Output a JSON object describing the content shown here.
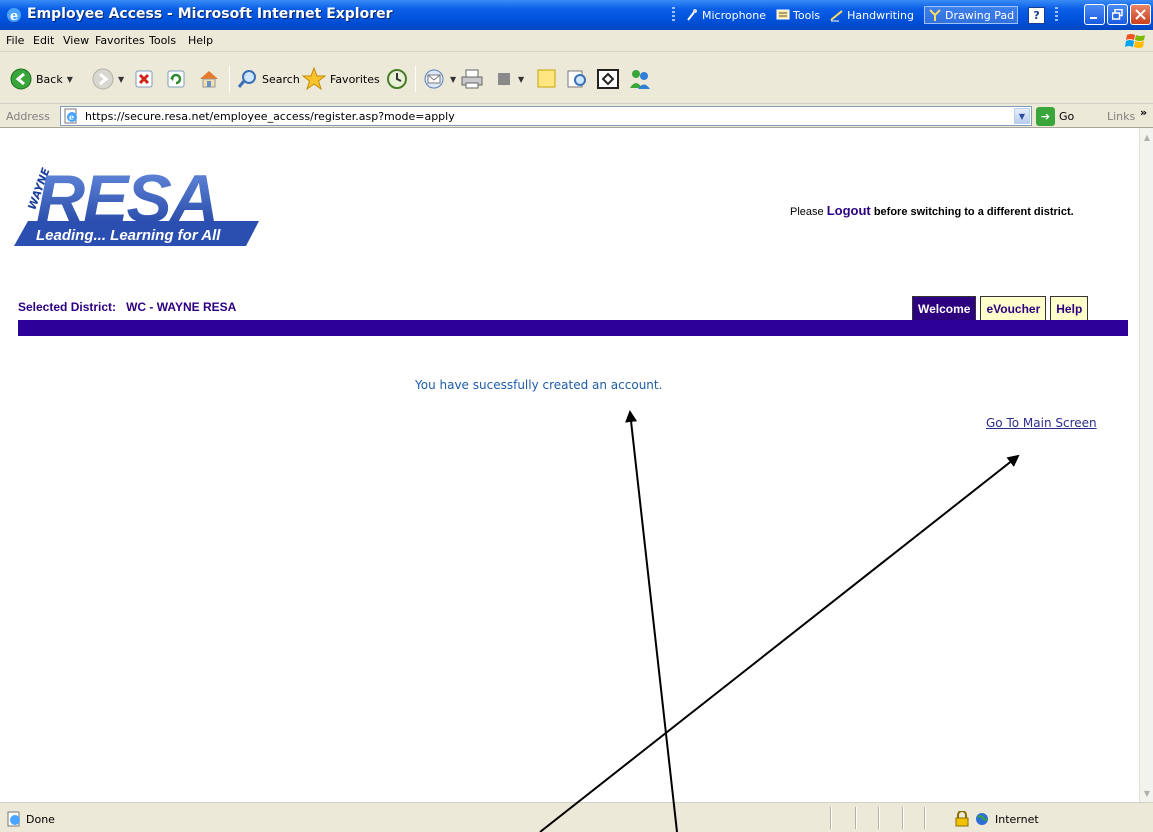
{
  "window": {
    "title": "Employee Access - Microsoft Internet Explorer",
    "langbar": {
      "microphone": "Microphone",
      "tools": "Tools",
      "handwriting": "Handwriting",
      "drawing_pad": "Drawing Pad",
      "help": "?"
    }
  },
  "menu": {
    "file": "File",
    "edit": "Edit",
    "view": "View",
    "favorites": "Favorites",
    "tools": "Tools",
    "help": "Help"
  },
  "toolbar": {
    "back": "Back",
    "search": "Search",
    "favorites": "Favorites"
  },
  "address": {
    "label": "Address",
    "url": "https://secure.resa.net/employee_access/register.asp?mode=apply",
    "go": "Go",
    "links": "Links",
    "links_chevron": "»"
  },
  "page": {
    "logo": {
      "wayne": "WAYNE",
      "resa": "RESA",
      "tagline": "Leading... Learning for All"
    },
    "logout_notice": {
      "prefix": "Please",
      "link": "Logout",
      "suffix": "before switching to a different district."
    },
    "selected_district_label": "Selected District:",
    "selected_district_value": "WC - WAYNE RESA",
    "tabs": [
      {
        "label": "Welcome",
        "active": true
      },
      {
        "label": "eVoucher",
        "active": false
      },
      {
        "label": "Help",
        "active": false
      }
    ],
    "success_message": "You have sucessfully created an account.",
    "main_screen_link": "Go To Main Screen"
  },
  "status": {
    "text": "Done",
    "zone": "Internet"
  },
  "colors": {
    "brand_purple": "#2c0099",
    "tab_inactive_bg": "#ffffcc",
    "message_blue": "#1f5da8",
    "titlebar_blue": "#0050d8"
  }
}
